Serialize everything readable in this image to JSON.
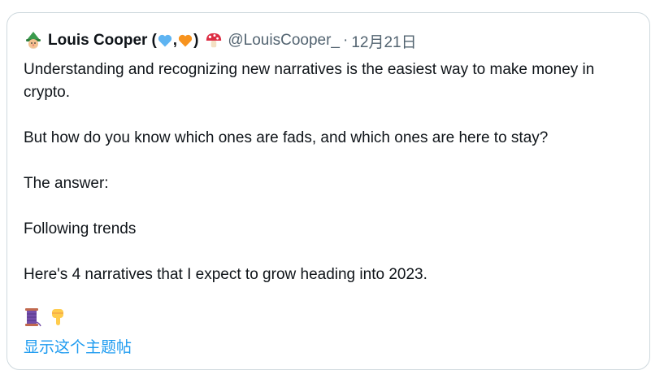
{
  "tweet": {
    "author": {
      "name": "Louis Cooper",
      "name_suffix_open": "(",
      "name_suffix_comma": ",",
      "name_suffix_close": ")",
      "handle": "@LouisCooper_",
      "separator": "·",
      "date": "12月21日",
      "avatar_icon": "wizard-avatar",
      "badge_icons": [
        "blue-heart-icon",
        "orange-heart-icon",
        "mushroom-icon"
      ],
      "colors": {
        "blue_heart": "#5eb4f2",
        "orange_heart": "#f7931e",
        "mushroom": "#dd2e44"
      }
    },
    "paragraphs": [
      "Understanding and recognizing new narratives is the easiest way to make money in crypto.",
      "But how do you know which ones are fads, and which ones are here to stay?",
      "The answer:",
      "Following trends",
      "Here's 4 narratives that I expect to grow heading into 2023."
    ],
    "footer_icons": [
      "thread-spool-icon",
      "pointing-down-icon"
    ],
    "show_thread_label": "显示这个主题帖",
    "colors": {
      "text": "#0f1419",
      "secondary": "#536471",
      "link": "#1d9bf0",
      "border": "#cfd9de"
    }
  }
}
